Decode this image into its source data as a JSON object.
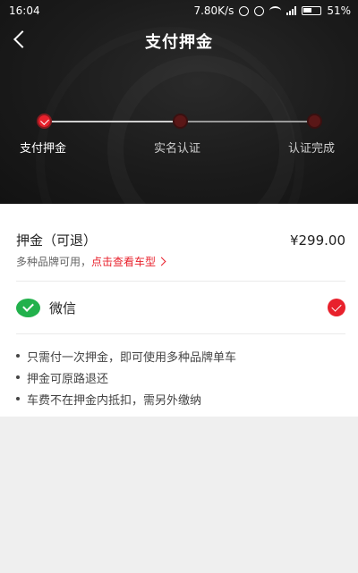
{
  "status_bar": {
    "time": "16:04",
    "network_speed": "7.80K/s",
    "battery": "51%"
  },
  "header": {
    "title": "支付押金"
  },
  "steps": [
    {
      "label": "支付押金",
      "state": "active"
    },
    {
      "label": "实名认证",
      "state": "pending"
    },
    {
      "label": "认证完成",
      "state": "pending"
    }
  ],
  "deposit": {
    "title": "押金（可退）",
    "amount": "¥299.00",
    "brand_text": "多种品牌可用，",
    "brand_link": "点击查看车型"
  },
  "payment": {
    "method_label": "微信",
    "selected": true
  },
  "notes": [
    "只需付一次押金，即可使用多种品牌单车",
    "押金可原路退还",
    "车费不在押金内抵扣，需另外缴纳"
  ],
  "colors": {
    "accent": "#e8212c",
    "wechat": "#22b14c",
    "hero_bg": "#1b1b1b"
  }
}
